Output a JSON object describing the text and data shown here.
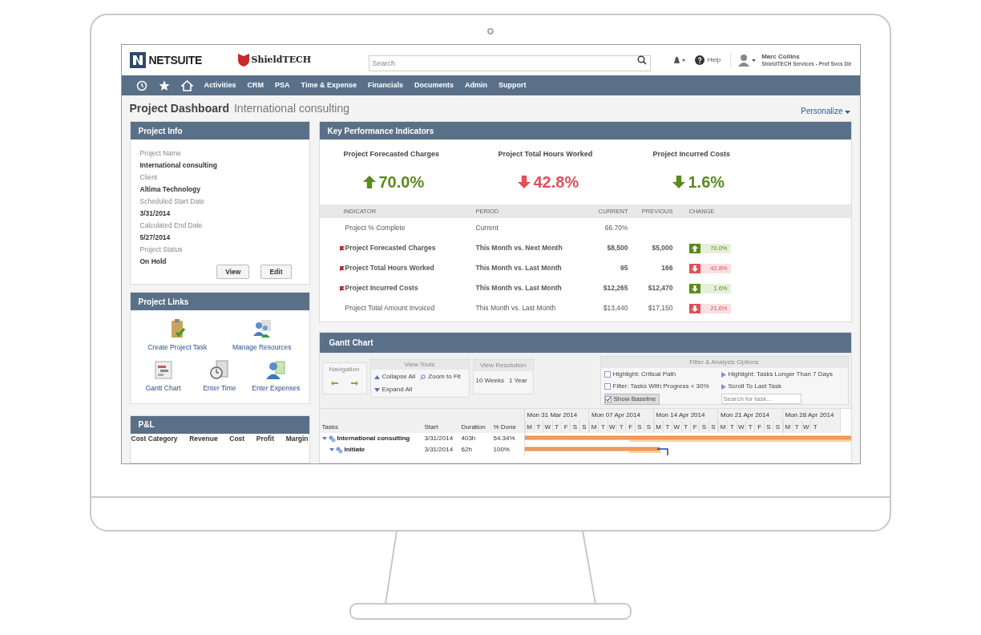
{
  "header": {
    "logo": "NETSUITE",
    "brand": "ShieldTECH",
    "search": {
      "placeholder": "Search"
    },
    "help": "Help",
    "user_name": "Marc Collins",
    "user_org": "ShieldTECH Services - Prof Svcs Dir"
  },
  "nav": [
    "Activities",
    "CRM",
    "PSA",
    "Time & Expense",
    "Financials",
    "Documents",
    "Admin",
    "Support"
  ],
  "page": {
    "title": "Project Dashboard",
    "subtitle": "International consulting",
    "personalize": "Personalize"
  },
  "project_info": {
    "title": "Project Info",
    "fields": [
      {
        "label": "Project Name",
        "value": "International consulting"
      },
      {
        "label": "Client",
        "value": "Altima Technology"
      },
      {
        "label": "Scheduled Start Date",
        "value": "3/31/2014"
      },
      {
        "label": "Calculated End Date",
        "value": "5/27/2014"
      },
      {
        "label": "Project Status",
        "value": "On Hold"
      }
    ],
    "buttons": [
      "View",
      "Edit"
    ]
  },
  "project_links": {
    "title": "Project Links",
    "links": [
      {
        "label": "Create Project Task",
        "kind": "clipboard"
      },
      {
        "label": "Manage Resources",
        "kind": "people"
      },
      {
        "label": "Gantt Chart",
        "kind": "chart"
      },
      {
        "label": "Enter Time",
        "kind": "clock"
      },
      {
        "label": "Enter Expenses",
        "kind": "person"
      }
    ]
  },
  "pl": {
    "title": "P&L",
    "columns": [
      "Cost Category",
      "Revenue",
      "Cost",
      "Profit",
      "Margin"
    ]
  },
  "kpi": {
    "title": "Key Performance Indicators",
    "cards": [
      {
        "title": "Project Forecasted Charges",
        "value": "70.0%",
        "increase": true,
        "favorable": true
      },
      {
        "title": "Project Total Hours Worked",
        "value": "42.8%",
        "increase": false,
        "favorable": false
      },
      {
        "title": "Project Incurred Costs",
        "value": "1.6%",
        "increase": false,
        "favorable": true
      }
    ],
    "columns": [
      "INDICATOR",
      "PERIOD",
      "CURRENT",
      "PREVIOUS",
      "CHANGE"
    ],
    "rows": [
      {
        "indicator": "Project % Complete",
        "period": "Current",
        "current": "66.70%",
        "flagged": false,
        "bold": false
      },
      {
        "indicator": "Project Forecasted Charges",
        "period": "This Month vs. Next Month",
        "current": "$8,500",
        "previous": "$5,000",
        "flagged": true,
        "bold": true,
        "change": {
          "value": "70.0%",
          "increase": true,
          "favorable": true
        }
      },
      {
        "indicator": "Project Total Hours Worked",
        "period": "This Month vs. Last Month",
        "current": "95",
        "previous": "166",
        "flagged": true,
        "bold": true,
        "change": {
          "value": "42.8%",
          "increase": false,
          "favorable": false
        }
      },
      {
        "indicator": "Project Incurred Costs",
        "period": "This Month vs. Last Month",
        "current": "$12,265",
        "previous": "$12,470",
        "flagged": true,
        "bold": true,
        "change": {
          "value": "1.6%",
          "increase": false,
          "favorable": true
        }
      },
      {
        "indicator": "Project Total Amount Invoiced",
        "period": "This Month vs. Last Month",
        "current": "$13,440",
        "previous": "$17,150",
        "flagged": false,
        "bold": false,
        "change": {
          "value": "21.6%",
          "increase": false,
          "favorable": false
        }
      }
    ]
  },
  "gantt": {
    "title": "Gantt Chart",
    "navigation": {
      "title": "Navigation"
    },
    "view_tools": {
      "title": "View Tools",
      "collapse": "Collapse All",
      "zoom": "Zoom to Fit",
      "expand": "Expand All"
    },
    "resolution": {
      "title": "View Resolution",
      "options": [
        "10 Weeks",
        "1 Year"
      ]
    },
    "filter": {
      "title": "Filter & Analysis Options",
      "checks": [
        {
          "label": "Highlight: Critical Path",
          "checked": false
        },
        {
          "label": "Filter: Tasks With Progress < 30%",
          "checked": false
        },
        {
          "label": "Show Baseline",
          "checked": true
        }
      ],
      "actions": [
        "Highlight: Tasks Longer Than 7 Days",
        "Scroll To Last Task"
      ],
      "search": {
        "placeholder": "Search for task..."
      }
    },
    "columns": [
      "Tasks",
      "Start",
      "Duration",
      "% Done"
    ],
    "weeks": [
      {
        "label": "Mon 31 Mar 2014",
        "days": [
          "M",
          "T",
          "W",
          "T",
          "F",
          "S",
          "S"
        ]
      },
      {
        "label": "Mon 07 Apr 2014",
        "days": [
          "M",
          "T",
          "W",
          "T",
          "F",
          "S",
          "S"
        ]
      },
      {
        "label": "Mon 14 Apr 2014",
        "days": [
          "M",
          "T",
          "W",
          "T",
          "F",
          "S",
          "S"
        ]
      },
      {
        "label": "Mon 21 Apr 2014",
        "days": [
          "M",
          "T",
          "W",
          "T",
          "F",
          "S",
          "S"
        ]
      },
      {
        "label": "Mon 28 Apr 2014",
        "days": [
          "M",
          "T",
          "W",
          "T"
        ]
      }
    ],
    "tasks": [
      {
        "name": "International consulting",
        "start": "3/31/2014",
        "duration": "403h",
        "done": "54.34%",
        "expanded": true,
        "children": [
          {
            "name": "Initiate",
            "start": "3/31/2014",
            "duration": "62h",
            "done": "100%",
            "expanded": true
          }
        ]
      }
    ]
  }
}
